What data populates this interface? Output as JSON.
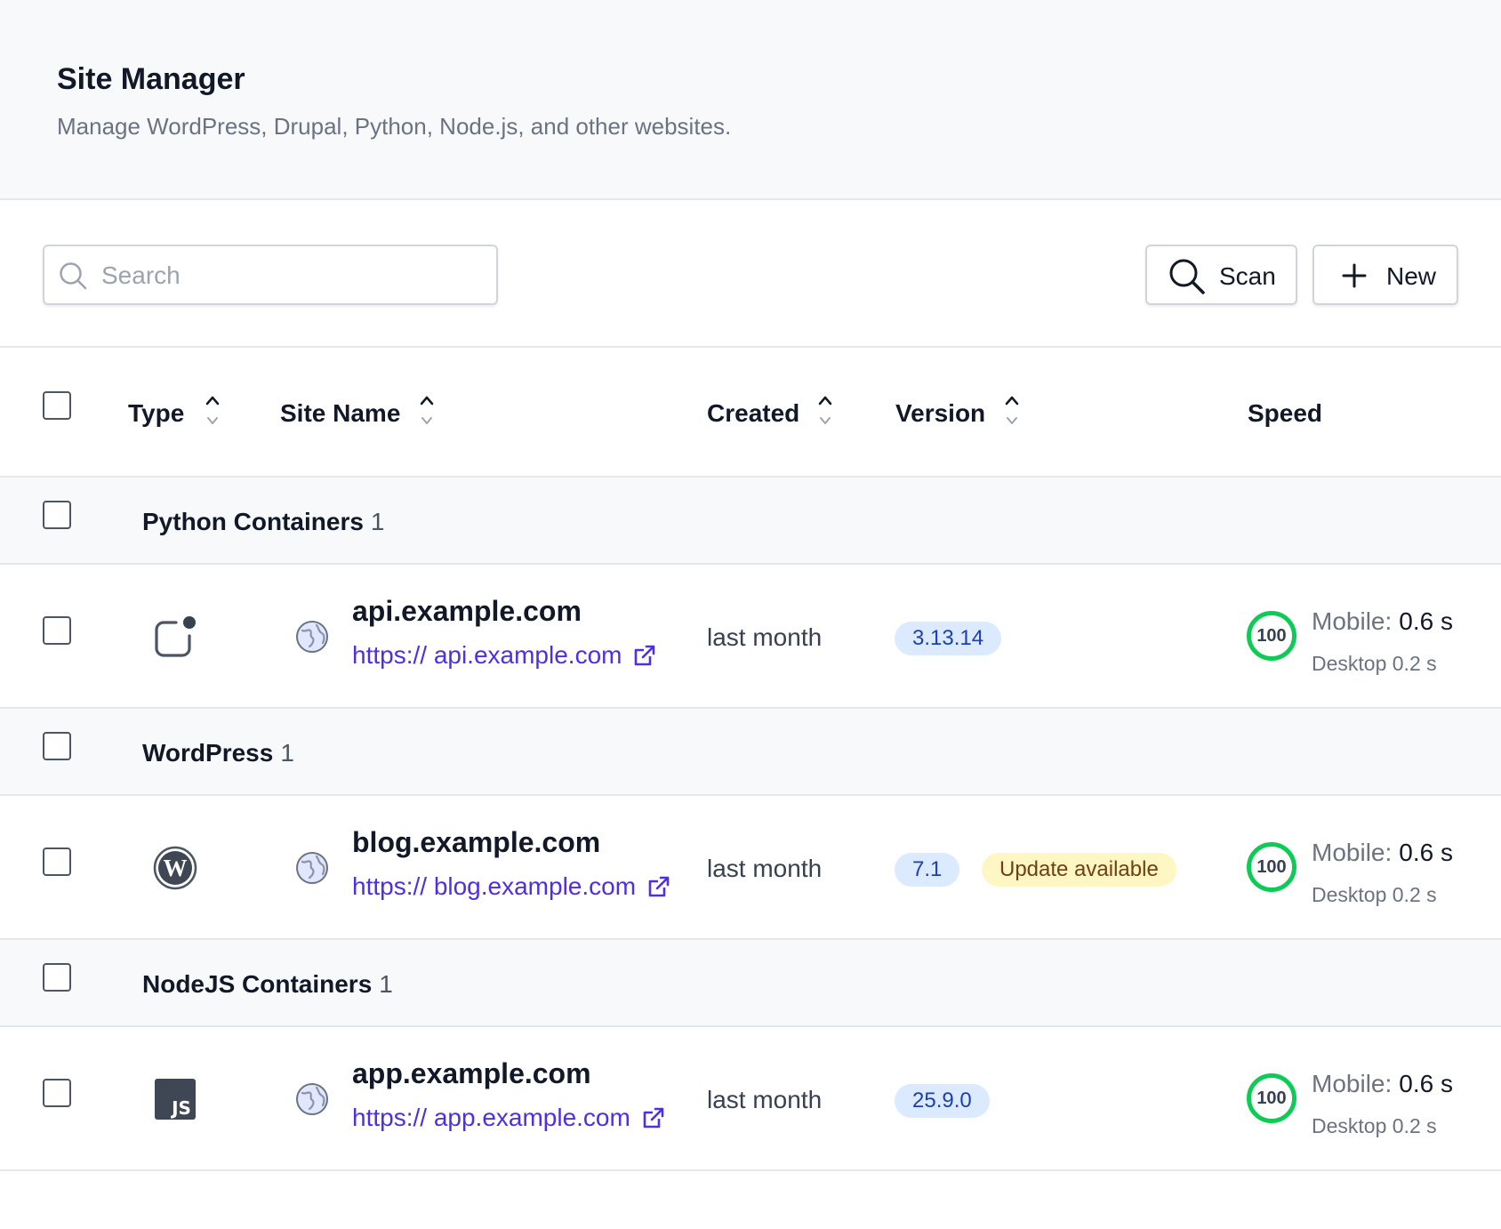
{
  "header": {
    "title": "Site Manager",
    "subtitle": "Manage WordPress, Drupal, Python, Node.js, and other websites."
  },
  "toolbar": {
    "search_placeholder": "Search",
    "search_value": "",
    "scan_label": "Scan",
    "new_label": "New"
  },
  "columns": {
    "type": "Type",
    "site_name": "Site Name",
    "created": "Created",
    "version": "Version",
    "speed": "Speed"
  },
  "groups": [
    {
      "name": "Python Containers",
      "count": "1",
      "site": {
        "type_icon": "python-container-icon",
        "name": "api.example.com",
        "url": "https:// api.example.com",
        "created": "last month",
        "version": "3.13.14",
        "update": "",
        "score": "100",
        "mobile_label": "Mobile:",
        "mobile_value": "0.6 s",
        "desktop": "Desktop 0.2 s"
      }
    },
    {
      "name": "WordPress",
      "count": "1",
      "site": {
        "type_icon": "wordpress-icon",
        "name": "blog.example.com",
        "url": "https:// blog.example.com",
        "created": "last month",
        "version": "7.1",
        "update": "Update available",
        "score": "100",
        "mobile_label": "Mobile:",
        "mobile_value": "0.6 s",
        "desktop": "Desktop 0.2 s"
      }
    },
    {
      "name": "NodeJS Containers",
      "count": "1",
      "site": {
        "type_icon": "nodejs-icon",
        "name": "app.example.com",
        "url": "https:// app.example.com",
        "created": "last month",
        "version": "25.9.0",
        "update": "",
        "score": "100",
        "mobile_label": "Mobile:",
        "mobile_value": "0.6 s",
        "desktop": "Desktop 0.2 s"
      }
    }
  ],
  "colors": {
    "link": "#4f2fe0",
    "score_ring": "#0ecb56",
    "version_badge_bg": "#dbeafe",
    "update_badge_bg": "#fef7c3",
    "header_bg": "#f8f9fb"
  }
}
